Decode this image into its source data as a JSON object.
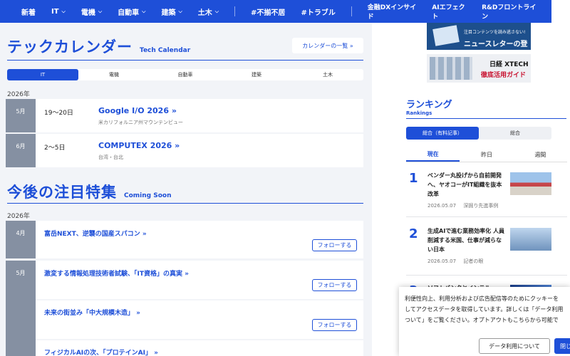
{
  "nav": {
    "items": [
      {
        "label": "新着",
        "chevron": false
      },
      {
        "label": "IT",
        "chevron": true
      },
      {
        "label": "電機",
        "chevron": true
      },
      {
        "label": "自動車",
        "chevron": true
      },
      {
        "label": "建築",
        "chevron": true
      },
      {
        "label": "土木",
        "chevron": true
      }
    ],
    "tags": [
      "#不揃不居",
      "#トラブル"
    ],
    "brands": [
      "金融DXインサイド",
      "AIエフェクト",
      "R&Dフロントライン"
    ]
  },
  "calendar": {
    "title": "テックカレンダー",
    "subtitle": "Tech Calendar",
    "list_button": "カレンダーの一覧 »",
    "tabs": [
      "IT",
      "電機",
      "自動車",
      "建築",
      "土木"
    ],
    "year": "2026年",
    "events": [
      {
        "month": "5月",
        "date": "19〜20日",
        "title": "Google I/O 2026 »",
        "place": "米カリフォルニア州マウンテンビュー"
      },
      {
        "month": "6月",
        "date": "2〜5日",
        "title": "COMPUTEX 2026 »",
        "place": "台湾・台北"
      }
    ]
  },
  "features": {
    "title": "今後の注目特集",
    "subtitle": "Coming Soon",
    "year": "2026年",
    "follow_label": "フォローする",
    "items": [
      {
        "month": "4月",
        "title": "富岳NEXT、逆襲の国産スパコン »"
      },
      {
        "month": "5月",
        "title": "激変する情報処理技術者試験、「IT資格」の真実 »"
      },
      {
        "month": "",
        "title": "未来の街並み「中大規模木造」 »"
      },
      {
        "month": "",
        "title": "フィジカルAIの次、「プロテインAI」 »"
      }
    ]
  },
  "banners": {
    "news_small": "注目コンテンツを読み逃さない!",
    "news_big": "ニュースレターの登録 »",
    "xtech_logo": "日経 XTECH",
    "xtech_guide": "徹底活用ガイド"
  },
  "ranking": {
    "title": "ランキング",
    "subtitle": "Rankings",
    "tabs": [
      "総合（有料記事）",
      "総合"
    ],
    "periods": [
      "現在",
      "昨日",
      "週間"
    ],
    "items": [
      {
        "rank": "1",
        "text": "ベンダー丸投げから自前開発へ、ヤオコーがIT組織を抜本改革",
        "date": "2026.05.07",
        "author": "深掘り先進事例"
      },
      {
        "rank": "2",
        "text": "生成AIで進む業務効率化 人員削減する米国、仕事が減らない日本",
        "date": "2026.05.07",
        "author": "記者の眼"
      },
      {
        "rank": "3",
        "text": "ソフトバンクとインテル、"
      }
    ]
  },
  "cookie": {
    "lines": [
      "利便性向上、利用分析および広告配信等のためにクッキーを",
      "してアクセスデータを取得しています。詳しくは「データ利用",
      "ついて」をご覧ください。オプトアウトもこちらから可能で"
    ],
    "data_button": "データ利用について",
    "close_button": "閉じ"
  },
  "colors": {
    "accent": "#1e4fd8",
    "month_badge": "#8590a2",
    "panel_bg": "#f2f4f8"
  }
}
